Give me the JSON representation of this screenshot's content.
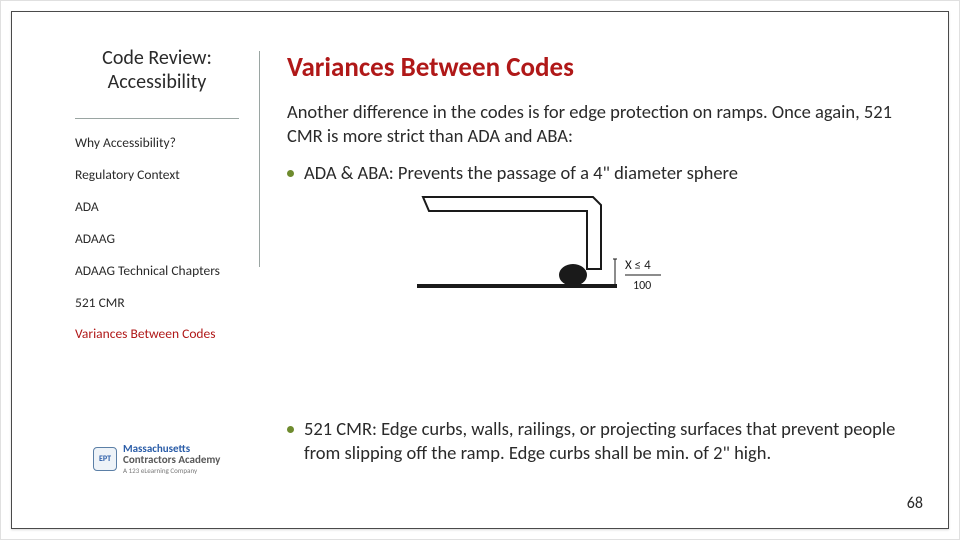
{
  "sidebar": {
    "title_line1": "Code Review:",
    "title_line2": "Accessibility",
    "items": [
      {
        "label": "Why Accessibility?",
        "active": false
      },
      {
        "label": "Regulatory Context",
        "active": false
      },
      {
        "label": "ADA",
        "active": false
      },
      {
        "label": "ADAAG",
        "active": false
      },
      {
        "label": "ADAAG Technical Chapters",
        "active": false
      },
      {
        "label": "521 CMR",
        "active": false
      },
      {
        "label": "Variances Between Codes",
        "active": true
      }
    ]
  },
  "main": {
    "title": "Variances Between Codes",
    "lead": "Another difference in the codes is for edge protection on ramps. Once again, 521 CMR is more strict than ADA and ABA:",
    "bullet1": "ADA & ABA: Prevents the passage of a 4\" diameter sphere",
    "bullet2": "521 CMR: Edge curbs, walls, railings, or projecting surfaces that prevent people from slipping off the ramp.  Edge curbs shall be min. of 2\" high."
  },
  "diagram": {
    "label_x": "X ≤ 4",
    "label_frac_top": "100",
    "alt": "ramp-edge-protection-cross-section"
  },
  "logo": {
    "badge": "EPT",
    "line1": "Massachusetts",
    "line2": "Contractors Academy",
    "sub": "A 123 eLearning Company"
  },
  "page_number": "68",
  "colors": {
    "accent": "#b01818",
    "bullet": "#6e8b2e"
  }
}
